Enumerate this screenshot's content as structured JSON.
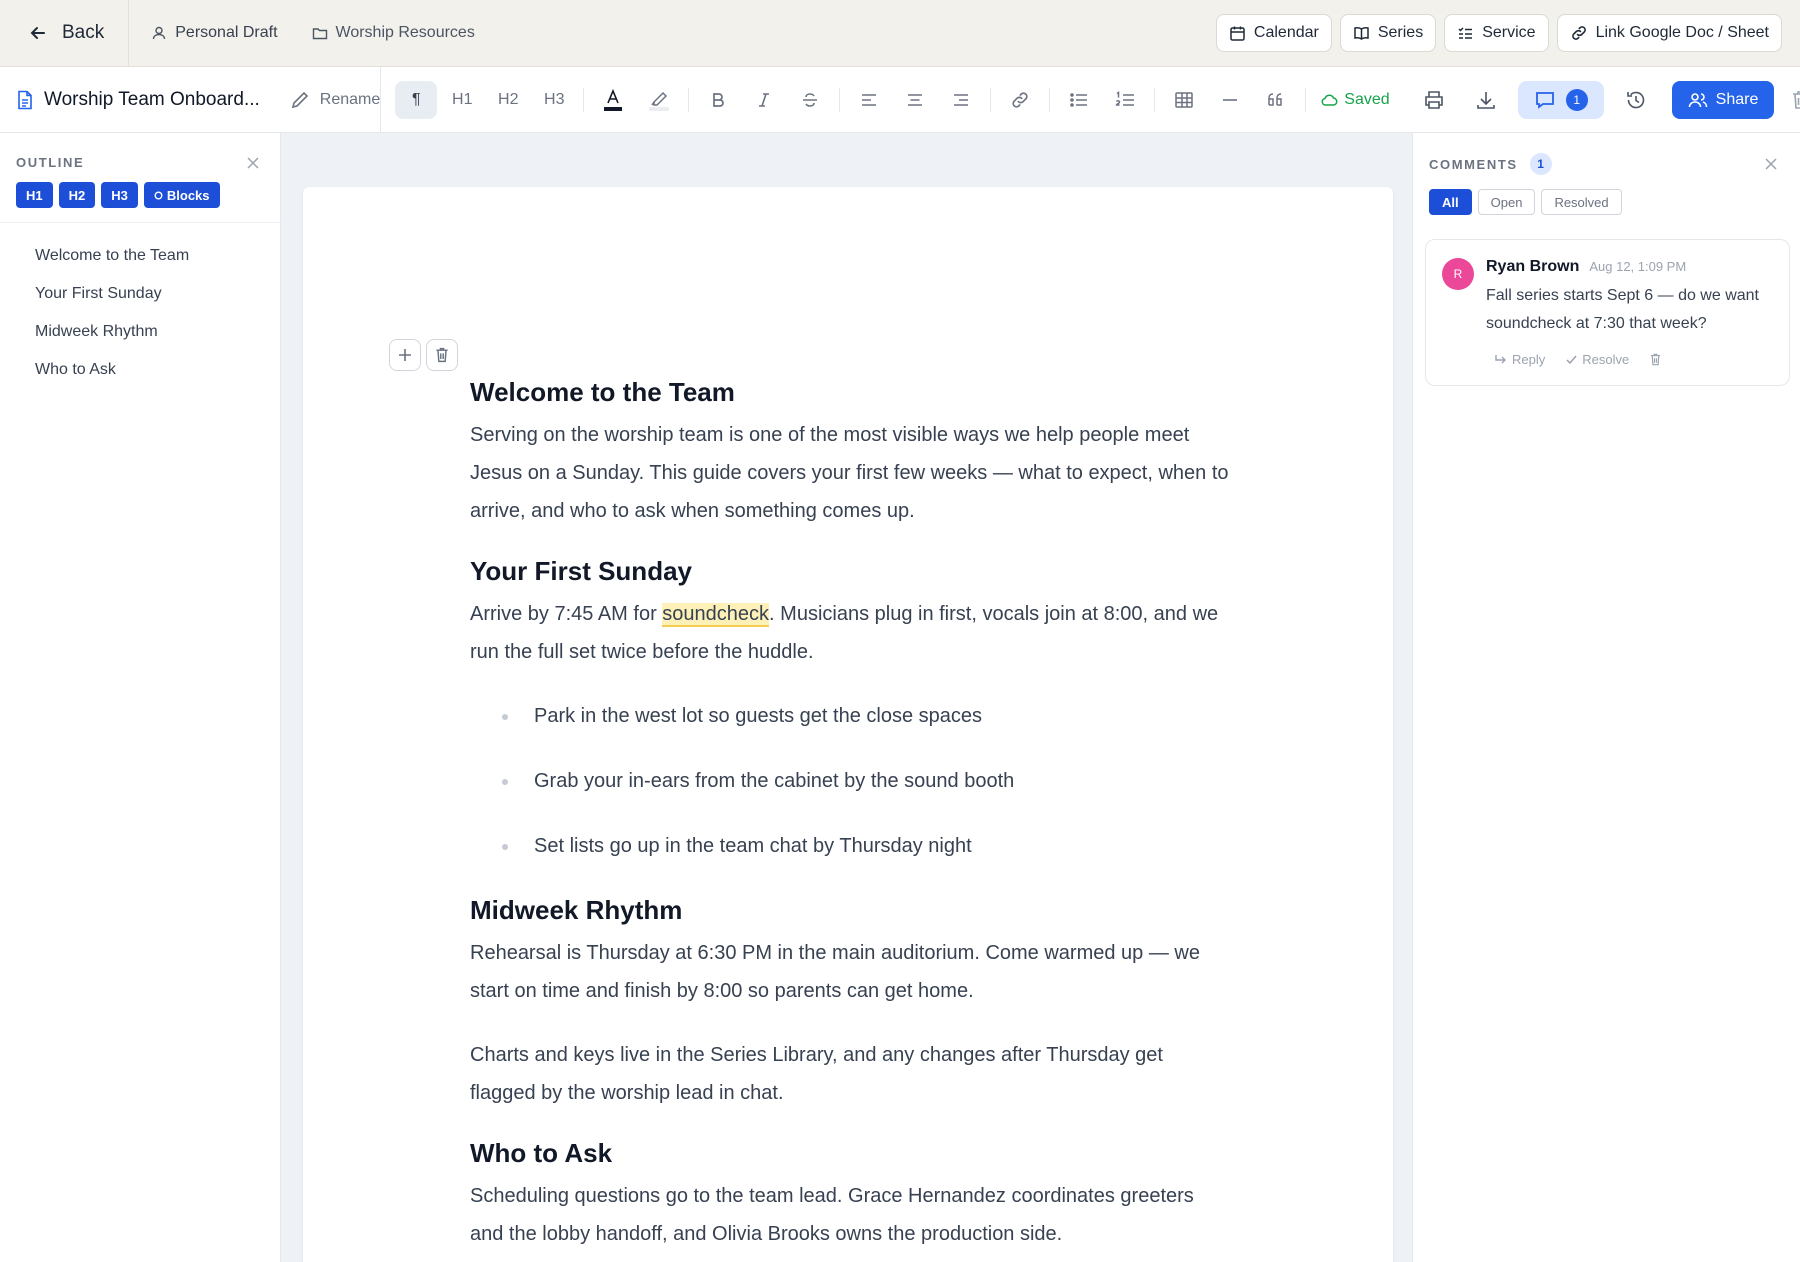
{
  "topbar": {
    "back_label": "Back",
    "crumbs": [
      "Personal Draft",
      "Worship Resources"
    ],
    "actions": [
      "Calendar",
      "Series",
      "Service",
      "Link Google Doc / Sheet"
    ]
  },
  "toolbar": {
    "doc_title": "Worship Team Onboard...",
    "rename_label": "Rename",
    "paragraph": "¶",
    "h1": "H1",
    "h2": "H2",
    "h3": "H3",
    "saved_label": "Saved",
    "comment_count": "1",
    "share_label": "Share"
  },
  "outline": {
    "title": "OUTLINE",
    "filters": [
      "H1",
      "H2",
      "H3",
      "Blocks"
    ],
    "items": [
      "Welcome to the Team",
      "Your First Sunday",
      "Midweek Rhythm",
      "Who to Ask"
    ]
  },
  "document": {
    "sections": [
      {
        "heading": "Welcome to the Team",
        "paragraph": "Serving on the worship team is one of the most visible ways we help people meet Jesus on a Sunday. This guide covers your first few weeks — what to expect, when to arrive, and who to ask when something comes up."
      },
      {
        "heading": "Your First Sunday",
        "paragraph_before": "Arrive by 7:45 AM for ",
        "highlight": "soundcheck",
        "paragraph_after": ". Musicians plug in first, vocals join at 8:00, and we run the full set twice before the huddle.",
        "bullets": [
          "Park in the west lot so guests get the close spaces",
          "Grab your in-ears from the cabinet by the sound booth",
          "Set lists go up in the team chat by Thursday night"
        ]
      },
      {
        "heading": "Midweek Rhythm",
        "paragraph": "Rehearsal is Thursday at 6:30 PM in the main auditorium. Come warmed up — we start on time and finish by 8:00 so parents can get home.",
        "paragraph2": "Charts and keys live in the Series Library, and any changes after Thursday get flagged by the worship lead in chat."
      },
      {
        "heading": "Who to Ask",
        "paragraph": "Scheduling questions go to the team lead. Grace Hernandez coordinates greeters and the lobby handoff, and Olivia Brooks owns the production side."
      }
    ]
  },
  "comments": {
    "title": "COMMENTS",
    "count": "1",
    "tabs": [
      "All",
      "Open",
      "Resolved"
    ],
    "items": [
      {
        "initial": "R",
        "author": "Ryan Brown",
        "time": "Aug 12, 1:09 PM",
        "text": "Fall series starts Sept 6 — do we want soundcheck at 7:30 that week?",
        "reply_label": "Reply",
        "resolve_label": "Resolve"
      }
    ]
  },
  "colors": {
    "accent": "#2563eb",
    "saved": "#16a34a",
    "highlight": "#fdf1b8",
    "avatar": "#ec4899"
  }
}
